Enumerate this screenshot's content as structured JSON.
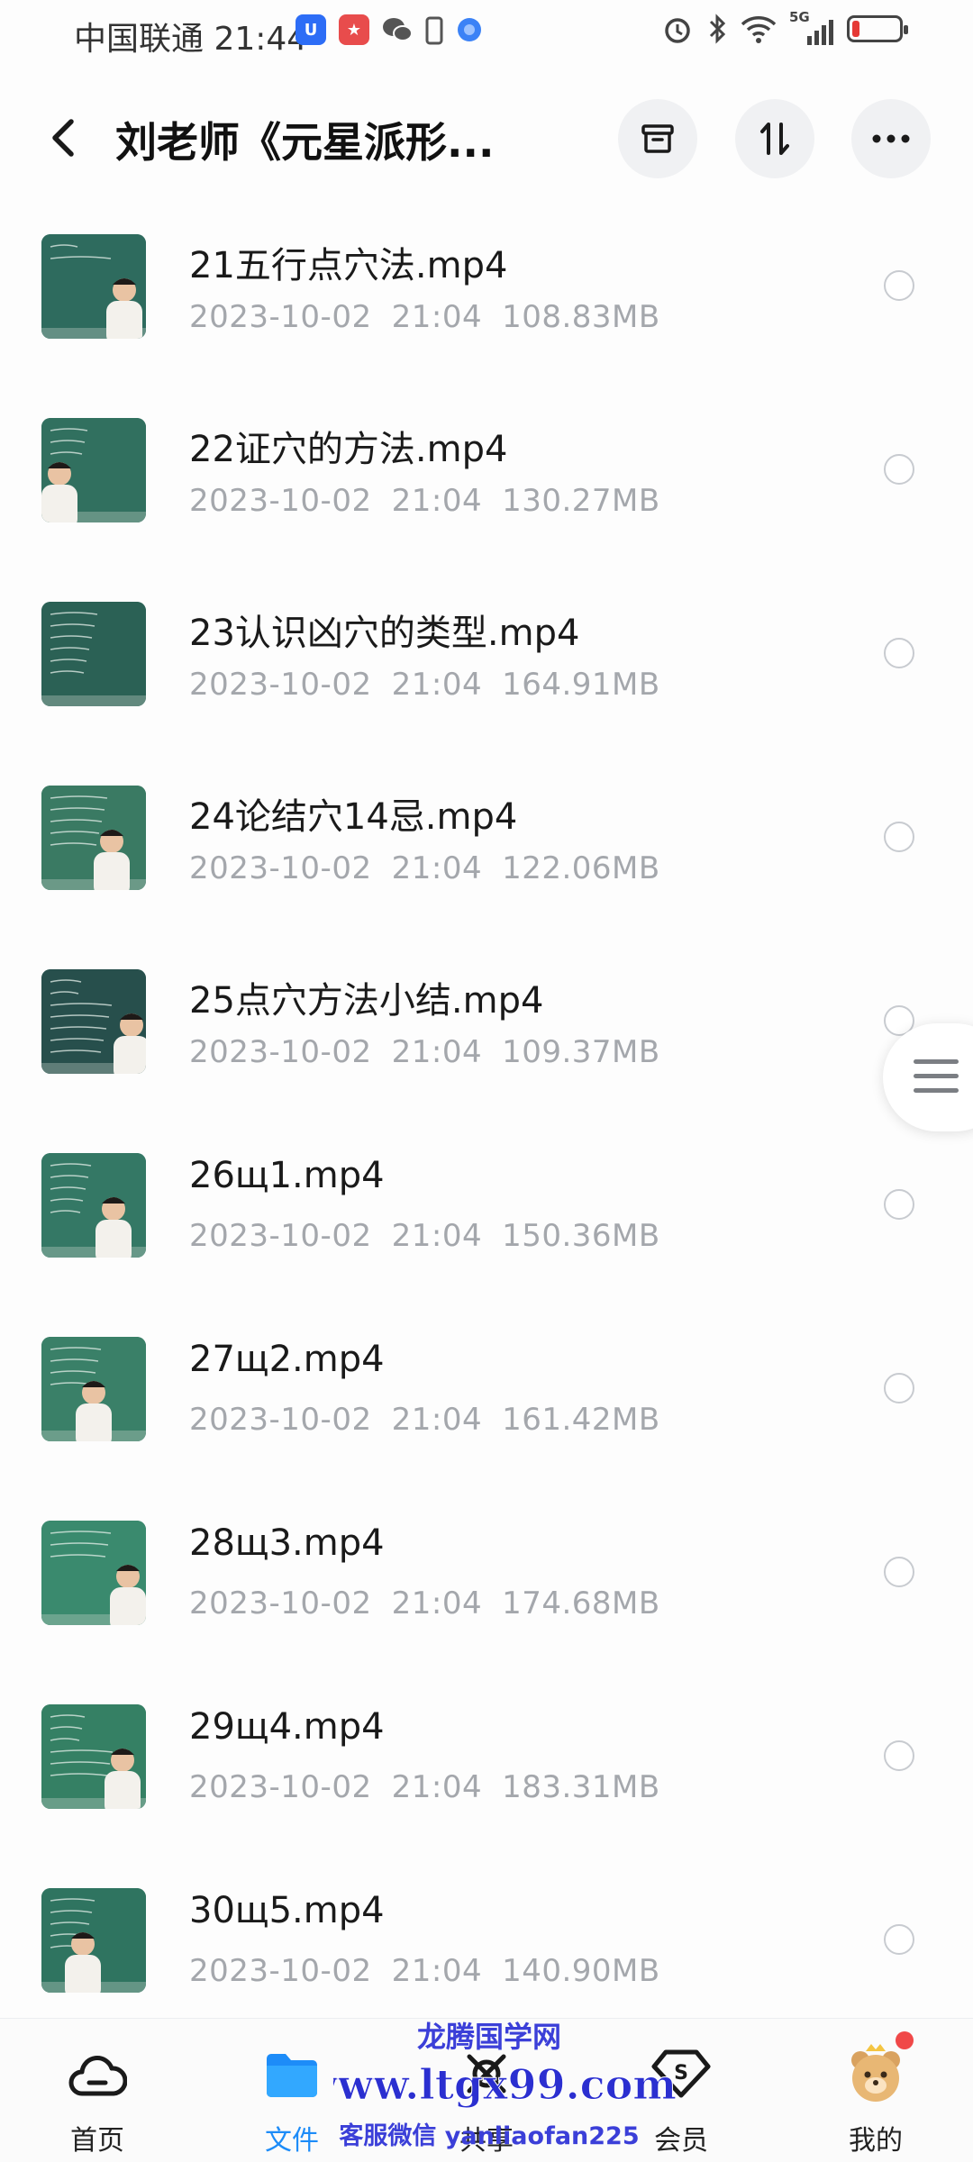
{
  "status_bar": {
    "carrier": "中国联通",
    "time": "21:44",
    "network": "5G",
    "battery_level": 0.15,
    "battery_color": "#e53935"
  },
  "header": {
    "back_icon": "chevron-left-icon",
    "title": "刘老师《元星派形...",
    "actions": [
      {
        "icon": "archive-icon"
      },
      {
        "icon": "sort-icon"
      },
      {
        "icon": "more-icon"
      }
    ]
  },
  "files": [
    {
      "name": "21五行点穴法.mp4",
      "date": "2023-10-02",
      "time": "21:04",
      "size": "108.83MB"
    },
    {
      "name": "22证穴的方法.mp4",
      "date": "2023-10-02",
      "time": "21:04",
      "size": "130.27MB"
    },
    {
      "name": "23认识凶穴的类型.mp4",
      "date": "2023-10-02",
      "time": "21:04",
      "size": "164.91MB"
    },
    {
      "name": "24论结穴14忌.mp4",
      "date": "2023-10-02",
      "time": "21:04",
      "size": "122.06MB"
    },
    {
      "name": "25点穴方法小结.mp4",
      "date": "2023-10-02",
      "time": "21:04",
      "size": "109.37MB"
    },
    {
      "name": "26щ1.mp4",
      "date": "2023-10-02",
      "time": "21:04",
      "size": "150.36MB"
    },
    {
      "name": "27щ2.mp4",
      "date": "2023-10-02",
      "time": "21:04",
      "size": "161.42MB"
    },
    {
      "name": "28щ3.mp4",
      "date": "2023-10-02",
      "time": "21:04",
      "size": "174.68MB"
    },
    {
      "name": "29щ4.mp4",
      "date": "2023-10-02",
      "time": "21:04",
      "size": "183.31MB"
    },
    {
      "name": "30щ5.mp4",
      "date": "2023-10-02",
      "time": "21:04",
      "size": "140.90MB"
    }
  ],
  "bottom_nav": [
    {
      "label": "首页",
      "icon": "cloud-home-icon",
      "active": false
    },
    {
      "label": "文件",
      "icon": "folder-icon",
      "active": true
    },
    {
      "label": "共享",
      "icon": "share-icon",
      "active": false
    },
    {
      "label": "会员",
      "icon": "vip-icon",
      "active": false
    },
    {
      "label": "我的",
      "icon": "avatar-icon",
      "active": false
    }
  ],
  "watermark": {
    "line1": "龙腾国学网",
    "line2": "www.ltgx99.com",
    "line3": "客服微信 yanliaofan225"
  },
  "colors": {
    "accent": "#1d8cf8",
    "meta_text": "#a4a7ac",
    "thumb_board": "#2f6a5c"
  }
}
